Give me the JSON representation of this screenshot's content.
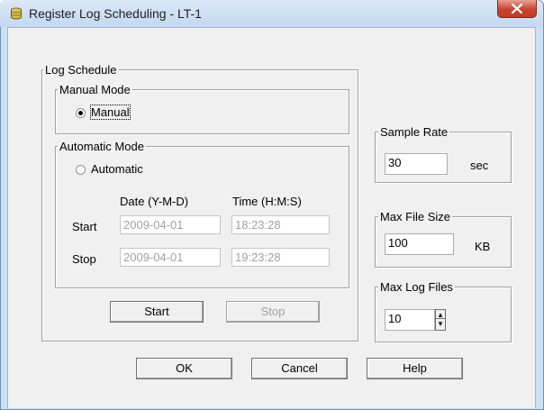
{
  "window": {
    "title": "Register Log Scheduling - LT-1"
  },
  "log_schedule": {
    "legend": "Log Schedule",
    "manual_mode": {
      "legend": "Manual Mode",
      "radio_label": "Manual",
      "selected": true
    },
    "automatic_mode": {
      "legend": "Automatic Mode",
      "radio_label": "Automatic",
      "selected": false,
      "date_header": "Date (Y-M-D)",
      "time_header": "Time (H:M:S)",
      "start_label": "Start",
      "stop_label": "Stop",
      "start_date": "2009-04-01",
      "start_time": "18:23:28",
      "stop_date": "2009-04-01",
      "stop_time": "19:23:28"
    },
    "start_button": "Start",
    "stop_button": "Stop"
  },
  "sample_rate": {
    "legend": "Sample Rate",
    "value": "30",
    "unit": "sec"
  },
  "max_file_size": {
    "legend": "Max File Size",
    "value": "100",
    "unit": "KB"
  },
  "max_log_files": {
    "legend": "Max Log Files",
    "value": "10"
  },
  "buttons": {
    "ok": "OK",
    "cancel": "Cancel",
    "help": "Help"
  },
  "icons": {
    "title": "log-cylinder-icon",
    "close": "close-icon",
    "spin_up": "spin-up-icon",
    "spin_down": "spin-down-icon"
  }
}
